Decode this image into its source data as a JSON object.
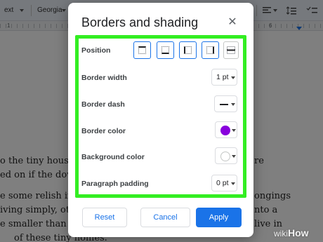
{
  "toolbar": {
    "style_label": "ext",
    "font_label": "Georgia"
  },
  "ruler": {
    "num_left": "1",
    "num_right": "6"
  },
  "document": {
    "lines": [
      "o the tiny house m",
      "ed on if the dow",
      "e some relish in",
      "iving simply, ot",
      "e smaller than 3",
      "of these tiny homes."
    ],
    "right_fragments": [
      "re",
      "ongings",
      "nto a",
      "live in"
    ]
  },
  "dialog": {
    "title": "Borders and shading",
    "close_glyph": "✕",
    "rows": {
      "position": "Position",
      "border_width": "Border width",
      "border_dash": "Border dash",
      "border_color": "Border color",
      "background_color": "Background color",
      "paragraph_padding": "Paragraph padding"
    },
    "border_width_value": "1 pt",
    "padding_value": "0 pt",
    "border_color_value": "#8800dd",
    "background_color_value": "#ffffff",
    "buttons": {
      "reset": "Reset",
      "cancel": "Cancel",
      "apply": "Apply"
    }
  },
  "colors": {
    "accent": "#1a73e8",
    "highlight": "#33ee22"
  },
  "watermark": {
    "prefix": "wiki",
    "suffix": "How"
  }
}
